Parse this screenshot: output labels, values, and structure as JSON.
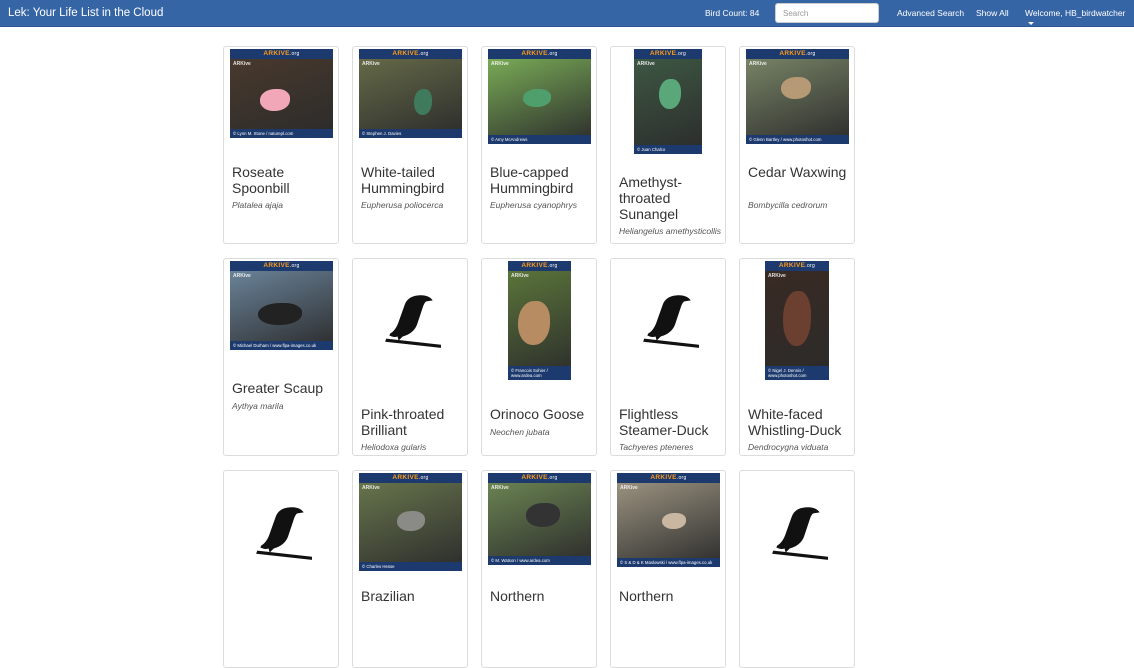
{
  "navbar": {
    "brand": "Lek: Your Life List in the Cloud",
    "bird_count": "Bird Count: 84",
    "search_placeholder": "Search",
    "advanced_search": "Advanced Search",
    "show_all": "Show All",
    "welcome": "Welcome, HB_birdwatcher"
  },
  "cards": [
    {
      "name": "Roseate Spoonbill",
      "sci": "Platalea ajaja",
      "image": "photo",
      "credit": "© Lynn M. Stone / naturepl.com"
    },
    {
      "name": "White-tailed Hummingbird",
      "sci": "Eupherusa poliocerca",
      "image": "photo",
      "credit": "© Stephen J. Davies"
    },
    {
      "name": "Blue-capped Hummingbird",
      "sci": "Eupherusa cyanophrys",
      "image": "photo",
      "credit": "© Amy McAndrews"
    },
    {
      "name": "Amethyst-throated Sunangel",
      "sci": "Heliangelus amethysticollis",
      "image": "photo",
      "credit": "© Juan Chalco"
    },
    {
      "name": "Cedar Waxwing",
      "sci": "Bombycilla cedrorum",
      "image": "photo",
      "credit": "© Glenn Bartley / www.photoshot.com"
    },
    {
      "name": "Greater Scaup",
      "sci": "Aythya marila",
      "image": "photo",
      "credit": "© Michael Durham / www.flpa-images.co.uk"
    },
    {
      "name": "Pink-throated Brilliant",
      "sci": "Heliodoxa gularis",
      "image": "silhouette",
      "credit": ""
    },
    {
      "name": "Orinoco Goose",
      "sci": "Neochen jubata",
      "image": "photo",
      "credit": "© Francois Sohier / www.ardea.com"
    },
    {
      "name": "Flightless Steamer-Duck",
      "sci": "Tachyeres pteneres",
      "image": "silhouette",
      "credit": ""
    },
    {
      "name": "White-faced Whistling-Duck",
      "sci": "Dendrocygna viduata",
      "image": "photo",
      "credit": "© Nigel J. Dennis / www.photoshot.com"
    },
    {
      "name": "",
      "sci": "",
      "image": "silhouette",
      "credit": ""
    },
    {
      "name": "Brazilian",
      "sci": "",
      "image": "photo",
      "credit": "© Charles Hesse"
    },
    {
      "name": "Northern",
      "sci": "",
      "image": "photo",
      "credit": "© M. Watson / www.ardea.com"
    },
    {
      "name": "Northern",
      "sci": "",
      "image": "photo",
      "credit": "© S & D & K Maslowski / www.flpa-images.co.uk"
    },
    {
      "name": "",
      "sci": "",
      "image": "silhouette",
      "credit": ""
    }
  ],
  "arkive_label": "ARKive",
  "arkive_org": ".org",
  "colors": {
    "navbar": "#3665a6",
    "arkive_band": "#1d3a6e",
    "arkive_orange": "#ff9b1a"
  }
}
